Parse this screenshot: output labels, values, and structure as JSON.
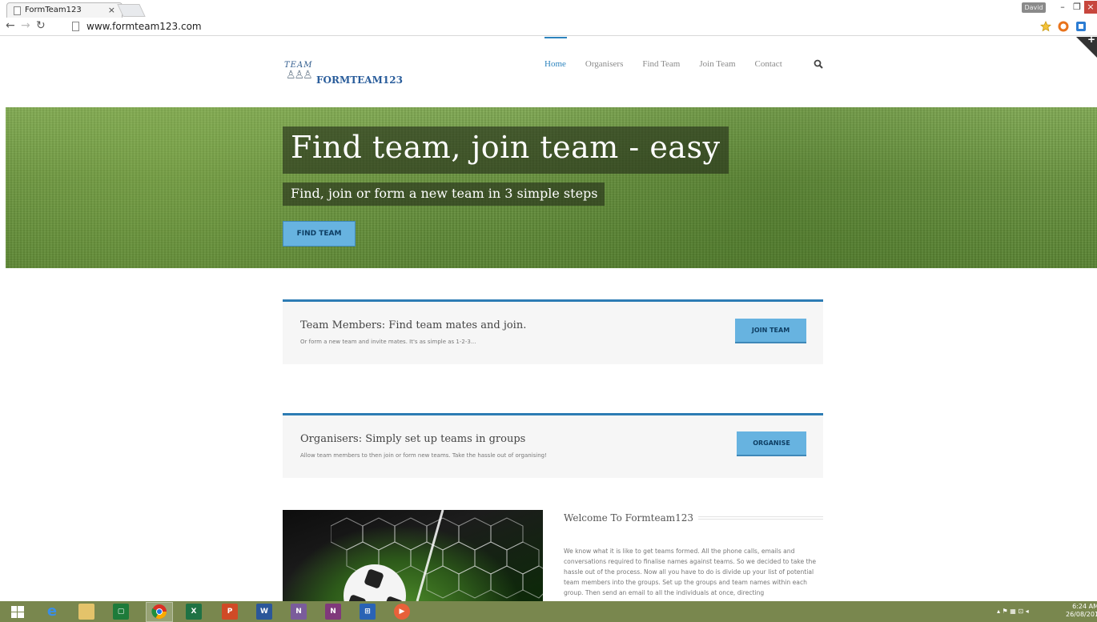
{
  "browser": {
    "tab_title": "FormTeam123",
    "tab_close": "×",
    "url": "www.formteam123.com",
    "user_badge": "David",
    "minimize": "–",
    "restore": "❐",
    "close": "×"
  },
  "site": {
    "logo_small": "TEAM",
    "logo_name": "FORMTEAM123",
    "nav": [
      "Home",
      "Organisers",
      "Find Team",
      "Join Team",
      "Contact"
    ],
    "active_nav": "Home"
  },
  "hero": {
    "title": "Find team, join team - easy",
    "subtitle": "Find, join or form a new team in 3 simple steps",
    "button": "FIND TEAM"
  },
  "cta_members": {
    "title": "Team Members: Find team mates and join.",
    "desc": "Or form a new team and invite mates. It's as simple as 1-2-3...",
    "button": "JOIN TEAM"
  },
  "cta_organisers": {
    "title": "Organisers: Simply set up teams in groups",
    "desc": "Allow team members to then join or form new teams. Take the hassle out of organising!",
    "button": "ORGANISE"
  },
  "welcome": {
    "heading": "Welcome To Formteam123",
    "body": "We know what it is like to get teams formed. All the phone calls, emails and conversations required to finalise names against teams. So we decided to take the hassle out of the process. Now all you have to do is divide up your list of potential team members into the groups. Set up the groups and team names within each group. Then send an email to all the individuals at once, directing"
  },
  "taskbar": {
    "time": "6:24 AM",
    "date": "26/08/201"
  },
  "colors": {
    "accent": "#2d84be",
    "button": "#67b3e0",
    "taskbar": "#79874e"
  }
}
